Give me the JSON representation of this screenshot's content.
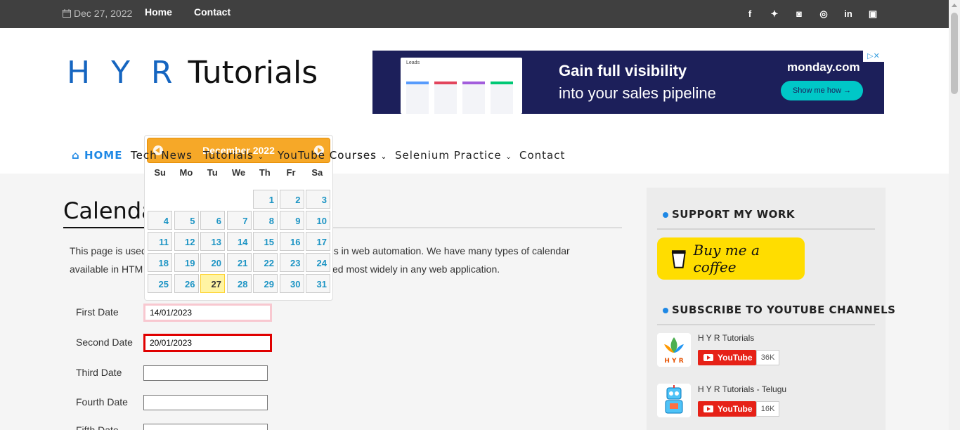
{
  "topbar": {
    "date": "Dec 27, 2022",
    "links": [
      "Home",
      "Contact"
    ],
    "social": [
      "f",
      "t",
      "g",
      "ig",
      "in",
      "yt"
    ]
  },
  "logo": {
    "part1": "H Y R",
    "part2": "Tutorials"
  },
  "ad": {
    "panel_label": "Leads",
    "headline": "Gain full visibility",
    "subline": "into your sales pipeline",
    "brand": "monday.com",
    "cta": "Show me how →",
    "badge": "▷✕"
  },
  "nav": {
    "home": "HOME",
    "items": [
      "Tech News",
      "Tutorials",
      "YouTube Courses",
      "Selenium Practice",
      "Contact"
    ]
  },
  "page": {
    "title": "Calenda",
    "para_line1_a": "This page is used",
    "para_line1_b": "s in web automation. We have many types of calendar",
    "para_line2_a": "available in HTM",
    "para_line2_b": "ed most widely in any web application."
  },
  "form": {
    "first_label": "First Date",
    "first_value": "14/01/2023",
    "second_label": "Second Date",
    "second_value": "20/01/2023",
    "third_label": "Third Date",
    "third_value": "",
    "fourth_label": "Fourth Date",
    "fourth_value": "",
    "fifth_label": "Fifth Date",
    "fifth_value": ""
  },
  "datepicker": {
    "title": "December  2022",
    "dows": [
      "Su",
      "Mo",
      "Tu",
      "We",
      "Th",
      "Fr",
      "Sa"
    ],
    "weeks": [
      [
        "",
        "",
        "",
        "",
        "1",
        "2",
        "3"
      ],
      [
        "4",
        "5",
        "6",
        "7",
        "8",
        "9",
        "10"
      ],
      [
        "11",
        "12",
        "13",
        "14",
        "15",
        "16",
        "17"
      ],
      [
        "18",
        "19",
        "20",
        "21",
        "22",
        "23",
        "24"
      ],
      [
        "25",
        "26",
        "27",
        "28",
        "29",
        "30",
        "31"
      ]
    ],
    "today": "27"
  },
  "sidebar": {
    "support_heading": "SUPPORT MY WORK",
    "coffee_label": "Buy me a coffee",
    "subscribe_heading": "SUBSCRIBE TO YOUTUBE CHANNELS",
    "channels": [
      {
        "name": "H Y R Tutorials",
        "icon_text": "H Y R",
        "button": "YouTube",
        "count": "36K"
      },
      {
        "name": "H Y R Tutorials - Telugu",
        "icon_text": "",
        "button": "YouTube",
        "count": "16K"
      }
    ]
  },
  "colors": {
    "accent": "#1e88e5",
    "datepicker_header": "#f6a828",
    "today": "#fff4a3",
    "topbar": "#404040"
  }
}
